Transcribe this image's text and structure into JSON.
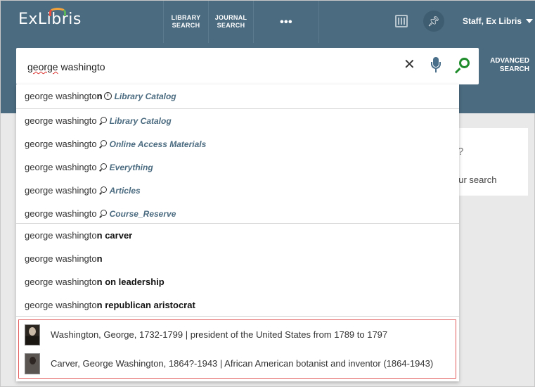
{
  "header": {
    "logo": "ExLibris",
    "nav": [
      {
        "line1": "LIBRARY",
        "line2": "SEARCH"
      },
      {
        "line1": "JOURNAL",
        "line2": "SEARCH"
      }
    ],
    "more_label": "•••",
    "user_label": "Staff, Ex Libris"
  },
  "search": {
    "query_underlined": "george",
    "query_rest": " washingto",
    "clear_label": "✕",
    "advanced_line1": "ADVANCED",
    "advanced_line2": "SEARCH"
  },
  "background_card": {
    "question_mark": "?",
    "text": "our search"
  },
  "suggestions": [
    {
      "prefix": "george washingto",
      "bold": "n",
      "scope": "Library Catalog",
      "icon": "clock-icon"
    },
    {
      "prefix": "george washingto",
      "bold": "",
      "scope": "Library Catalog",
      "icon": "search-icon"
    },
    {
      "prefix": "george washingto",
      "bold": "",
      "scope": "Online Access Materials",
      "icon": "search-icon"
    },
    {
      "prefix": "george washingto",
      "bold": "",
      "scope": "Everything",
      "icon": "search-icon"
    },
    {
      "prefix": "george washingto",
      "bold": "",
      "scope": "Articles",
      "icon": "search-icon"
    },
    {
      "prefix": "george washingto",
      "bold": "",
      "scope": "Course_Reserve",
      "icon": "search-icon"
    },
    {
      "prefix": "george washingto",
      "bold": "n carver"
    },
    {
      "prefix": "george washingto",
      "bold": "n"
    },
    {
      "prefix": "george washingto",
      "bold": "n on leadership"
    },
    {
      "prefix": "george washingto",
      "bold": "n republican aristocrat"
    }
  ],
  "authorities": [
    {
      "text": "Washington, George, 1732-1799 | president of the United States from 1789 to 1797"
    },
    {
      "text": "Carver, George Washington, 1864?-1943 | African American botanist and inventor (1864-1943)"
    }
  ],
  "colors": {
    "header_bg": "#4b6b80",
    "scope_text": "#4b6b80",
    "go_button": "#1f8c2c",
    "highlight_border": "#e35a5a"
  }
}
